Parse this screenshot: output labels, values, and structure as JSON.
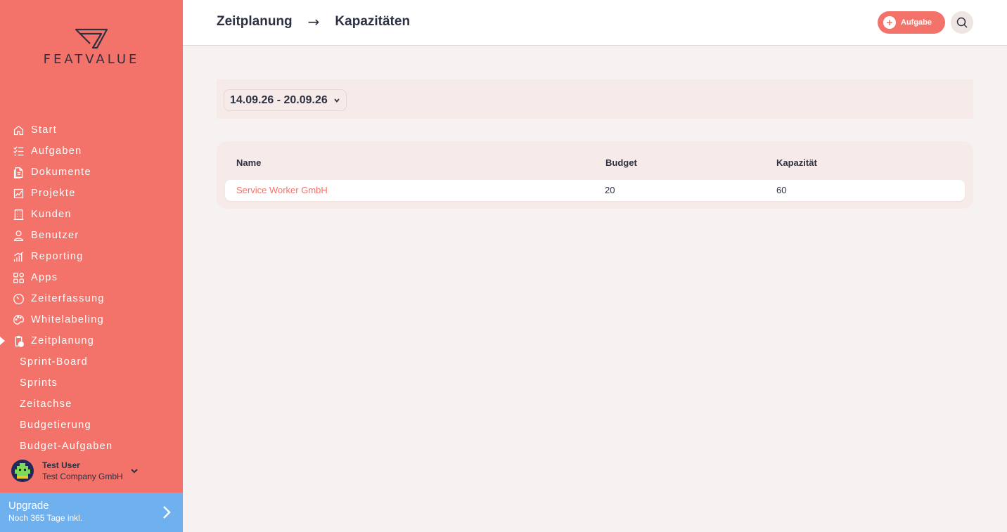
{
  "sidebar": {
    "logo_text": "FEATVALUE",
    "items": [
      {
        "label": "Start",
        "icon": "home-icon"
      },
      {
        "label": "Aufgaben",
        "icon": "task-list-icon"
      },
      {
        "label": "Dokumente",
        "icon": "document-icon"
      },
      {
        "label": "Projekte",
        "icon": "project-chart-icon"
      },
      {
        "label": "Kunden",
        "icon": "building-icon"
      },
      {
        "label": "Benutzer",
        "icon": "user-icon"
      },
      {
        "label": "Reporting",
        "icon": "bar-chart-icon"
      },
      {
        "label": "Apps",
        "icon": "apps-grid-icon"
      },
      {
        "label": "Zeiterfassung",
        "icon": "stopwatch-icon"
      },
      {
        "label": "Whitelabeling",
        "icon": "palette-icon"
      },
      {
        "label": "Zeitplanung",
        "icon": "clipboard-clock-icon",
        "active": true
      }
    ],
    "sub_items": [
      {
        "label": "Sprint-Board"
      },
      {
        "label": "Sprints"
      },
      {
        "label": "Zeitachse"
      },
      {
        "label": "Budgetierung"
      },
      {
        "label": "Budget-Aufgaben"
      }
    ],
    "user": {
      "name": "Test User",
      "company": "Test Company GmbH"
    },
    "upgrade": {
      "title": "Upgrade",
      "subtitle": "Noch 365 Tage inkl."
    }
  },
  "header": {
    "breadcrumb": [
      "Zeitplanung",
      "Kapazitäten"
    ],
    "arrow": "→",
    "add_task_label": "Aufgabe"
  },
  "filter": {
    "week_range": "14.09.26 - 20.09.26"
  },
  "table": {
    "headers": [
      "Name",
      "Budget",
      "Kapazität"
    ],
    "rows": [
      {
        "name": "Service Worker GmbH",
        "budget": "20",
        "capacity": "60"
      }
    ]
  },
  "colors": {
    "accent": "#f3736a",
    "upgrade": "#6fb0ef",
    "text": "#2d3142"
  }
}
